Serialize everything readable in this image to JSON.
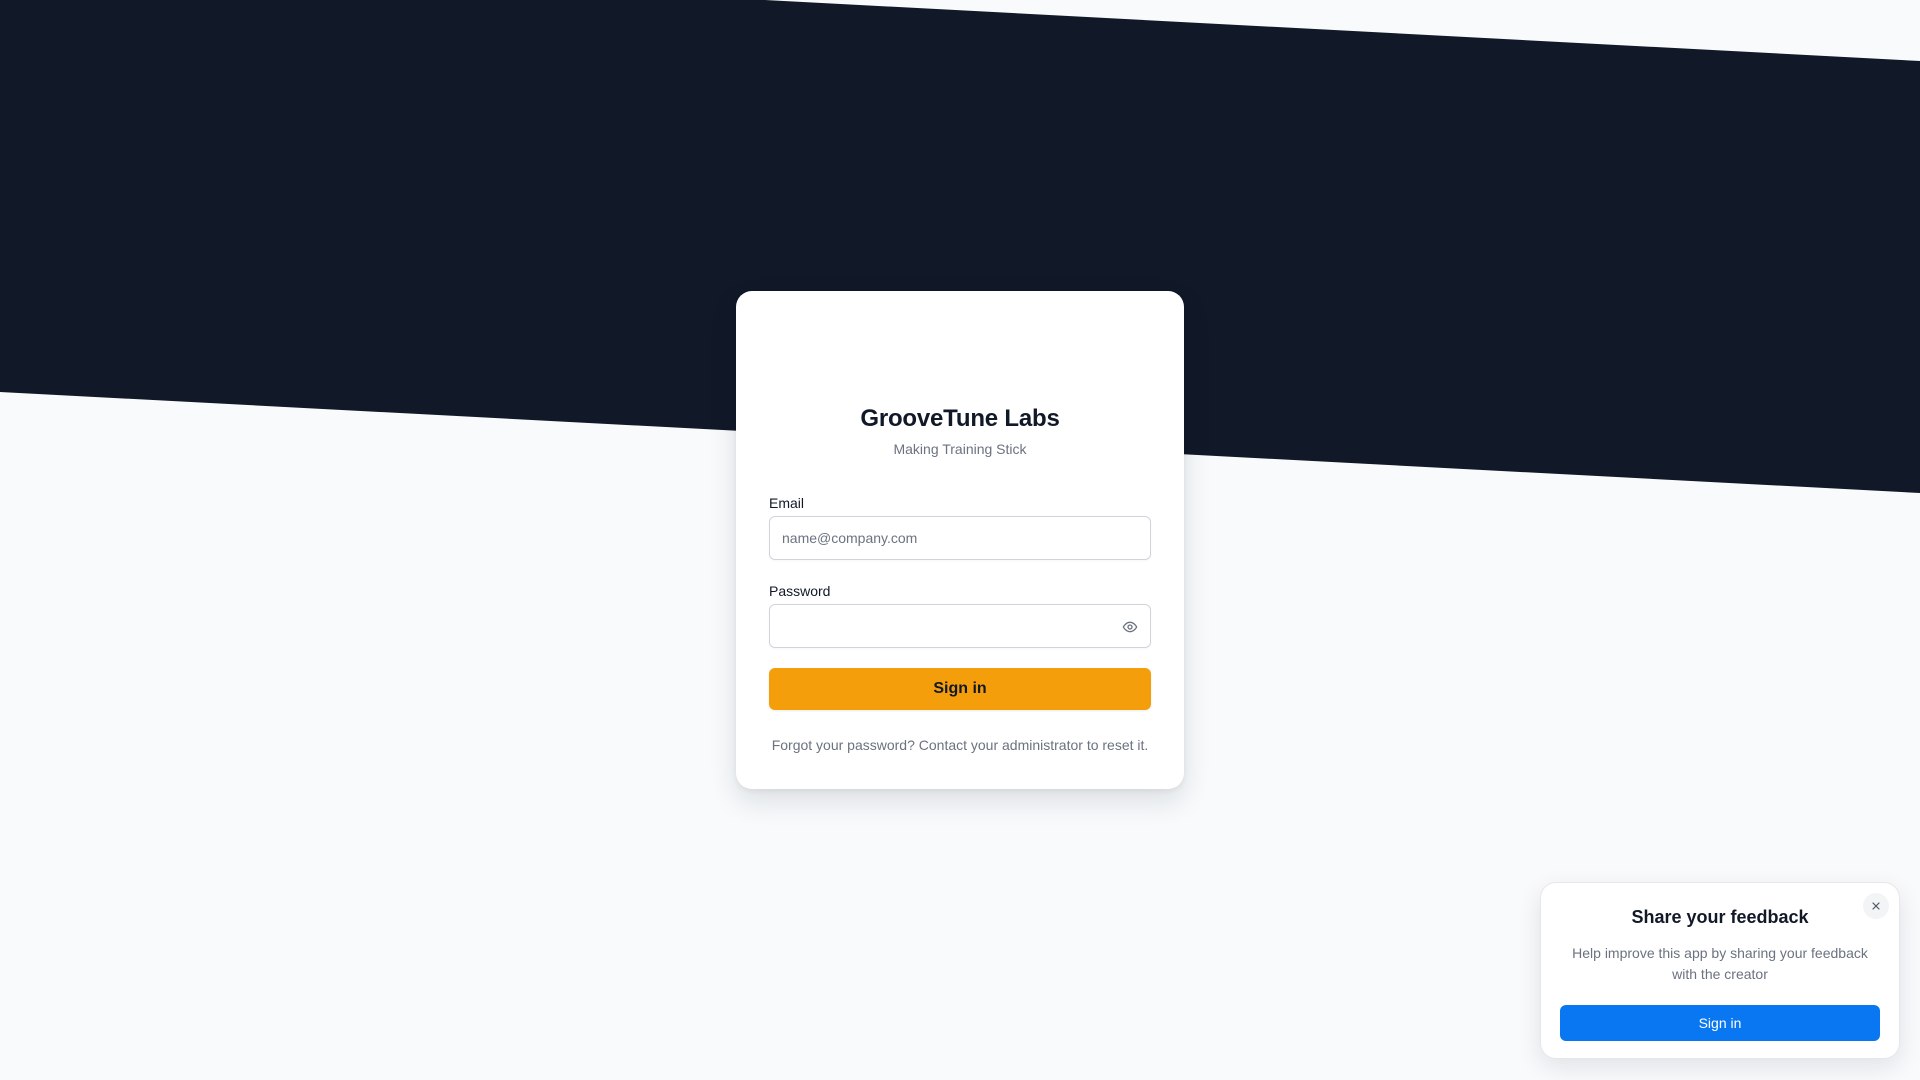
{
  "theme": {
    "background": "#f8fafc",
    "banner": "#111827",
    "accent": "#f59e0b",
    "feedback_button": "#0a77f2"
  },
  "brand": {
    "name": "GrooveTune Labs",
    "tagline": "Making Training Stick"
  },
  "login": {
    "email_label": "Email",
    "email_value": "",
    "email_placeholder": "name@company.com",
    "password_label": "Password",
    "password_value": "",
    "password_placeholder": "",
    "toggle_icon": "eye-icon",
    "submit_label": "Sign in",
    "forgot_text": "Forgot your password? Contact your administrator to reset it."
  },
  "feedback": {
    "title": "Share your feedback",
    "description": "Help improve this app by sharing your feedback with the creator",
    "button_label": "Sign in",
    "close_icon": "close-icon"
  }
}
